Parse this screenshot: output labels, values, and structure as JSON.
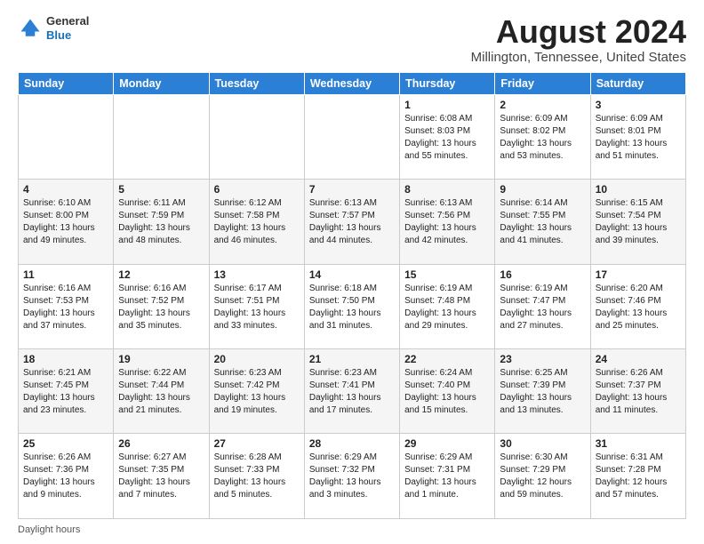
{
  "logo": {
    "general": "General",
    "blue": "Blue"
  },
  "title": "August 2024",
  "subtitle": "Millington, Tennessee, United States",
  "footer": "Daylight hours",
  "headers": [
    "Sunday",
    "Monday",
    "Tuesday",
    "Wednesday",
    "Thursday",
    "Friday",
    "Saturday"
  ],
  "weeks": [
    [
      {
        "day": "",
        "info": ""
      },
      {
        "day": "",
        "info": ""
      },
      {
        "day": "",
        "info": ""
      },
      {
        "day": "",
        "info": ""
      },
      {
        "day": "1",
        "info": "Sunrise: 6:08 AM\nSunset: 8:03 PM\nDaylight: 13 hours\nand 55 minutes."
      },
      {
        "day": "2",
        "info": "Sunrise: 6:09 AM\nSunset: 8:02 PM\nDaylight: 13 hours\nand 53 minutes."
      },
      {
        "day": "3",
        "info": "Sunrise: 6:09 AM\nSunset: 8:01 PM\nDaylight: 13 hours\nand 51 minutes."
      }
    ],
    [
      {
        "day": "4",
        "info": "Sunrise: 6:10 AM\nSunset: 8:00 PM\nDaylight: 13 hours\nand 49 minutes."
      },
      {
        "day": "5",
        "info": "Sunrise: 6:11 AM\nSunset: 7:59 PM\nDaylight: 13 hours\nand 48 minutes."
      },
      {
        "day": "6",
        "info": "Sunrise: 6:12 AM\nSunset: 7:58 PM\nDaylight: 13 hours\nand 46 minutes."
      },
      {
        "day": "7",
        "info": "Sunrise: 6:13 AM\nSunset: 7:57 PM\nDaylight: 13 hours\nand 44 minutes."
      },
      {
        "day": "8",
        "info": "Sunrise: 6:13 AM\nSunset: 7:56 PM\nDaylight: 13 hours\nand 42 minutes."
      },
      {
        "day": "9",
        "info": "Sunrise: 6:14 AM\nSunset: 7:55 PM\nDaylight: 13 hours\nand 41 minutes."
      },
      {
        "day": "10",
        "info": "Sunrise: 6:15 AM\nSunset: 7:54 PM\nDaylight: 13 hours\nand 39 minutes."
      }
    ],
    [
      {
        "day": "11",
        "info": "Sunrise: 6:16 AM\nSunset: 7:53 PM\nDaylight: 13 hours\nand 37 minutes."
      },
      {
        "day": "12",
        "info": "Sunrise: 6:16 AM\nSunset: 7:52 PM\nDaylight: 13 hours\nand 35 minutes."
      },
      {
        "day": "13",
        "info": "Sunrise: 6:17 AM\nSunset: 7:51 PM\nDaylight: 13 hours\nand 33 minutes."
      },
      {
        "day": "14",
        "info": "Sunrise: 6:18 AM\nSunset: 7:50 PM\nDaylight: 13 hours\nand 31 minutes."
      },
      {
        "day": "15",
        "info": "Sunrise: 6:19 AM\nSunset: 7:48 PM\nDaylight: 13 hours\nand 29 minutes."
      },
      {
        "day": "16",
        "info": "Sunrise: 6:19 AM\nSunset: 7:47 PM\nDaylight: 13 hours\nand 27 minutes."
      },
      {
        "day": "17",
        "info": "Sunrise: 6:20 AM\nSunset: 7:46 PM\nDaylight: 13 hours\nand 25 minutes."
      }
    ],
    [
      {
        "day": "18",
        "info": "Sunrise: 6:21 AM\nSunset: 7:45 PM\nDaylight: 13 hours\nand 23 minutes."
      },
      {
        "day": "19",
        "info": "Sunrise: 6:22 AM\nSunset: 7:44 PM\nDaylight: 13 hours\nand 21 minutes."
      },
      {
        "day": "20",
        "info": "Sunrise: 6:23 AM\nSunset: 7:42 PM\nDaylight: 13 hours\nand 19 minutes."
      },
      {
        "day": "21",
        "info": "Sunrise: 6:23 AM\nSunset: 7:41 PM\nDaylight: 13 hours\nand 17 minutes."
      },
      {
        "day": "22",
        "info": "Sunrise: 6:24 AM\nSunset: 7:40 PM\nDaylight: 13 hours\nand 15 minutes."
      },
      {
        "day": "23",
        "info": "Sunrise: 6:25 AM\nSunset: 7:39 PM\nDaylight: 13 hours\nand 13 minutes."
      },
      {
        "day": "24",
        "info": "Sunrise: 6:26 AM\nSunset: 7:37 PM\nDaylight: 13 hours\nand 11 minutes."
      }
    ],
    [
      {
        "day": "25",
        "info": "Sunrise: 6:26 AM\nSunset: 7:36 PM\nDaylight: 13 hours\nand 9 minutes."
      },
      {
        "day": "26",
        "info": "Sunrise: 6:27 AM\nSunset: 7:35 PM\nDaylight: 13 hours\nand 7 minutes."
      },
      {
        "day": "27",
        "info": "Sunrise: 6:28 AM\nSunset: 7:33 PM\nDaylight: 13 hours\nand 5 minutes."
      },
      {
        "day": "28",
        "info": "Sunrise: 6:29 AM\nSunset: 7:32 PM\nDaylight: 13 hours\nand 3 minutes."
      },
      {
        "day": "29",
        "info": "Sunrise: 6:29 AM\nSunset: 7:31 PM\nDaylight: 13 hours\nand 1 minute."
      },
      {
        "day": "30",
        "info": "Sunrise: 6:30 AM\nSunset: 7:29 PM\nDaylight: 12 hours\nand 59 minutes."
      },
      {
        "day": "31",
        "info": "Sunrise: 6:31 AM\nSunset: 7:28 PM\nDaylight: 12 hours\nand 57 minutes."
      }
    ]
  ]
}
